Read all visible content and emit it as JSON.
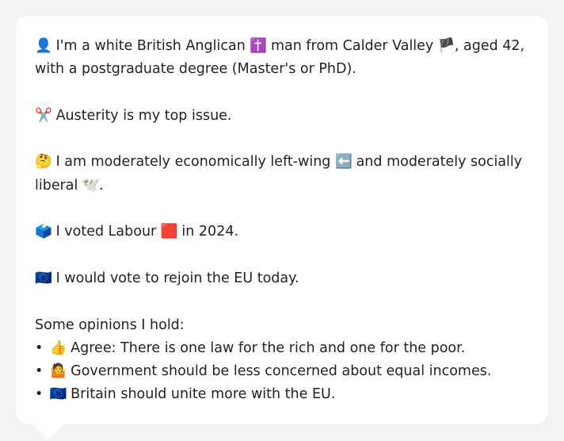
{
  "profile": {
    "identity_icon": "👤",
    "identity_text_1": "I'm a white British Anglican",
    "religion_icon": "✝️",
    "identity_text_2": "man from Calder Valley",
    "flag_icon": "🏴",
    "identity_text_3": ", aged 42, with a postgraduate degree (Master's or PhD)."
  },
  "top_issue": {
    "icon": "✂️",
    "text": "Austerity is my top issue."
  },
  "ideology": {
    "icon": "🤔",
    "text_1": "I am moderately economically left-wing",
    "left_icon": "⬅️",
    "text_2": "and moderately socially liberal",
    "dove_icon": "🕊️",
    "text_3": "."
  },
  "vote": {
    "icon": "🗳️",
    "text_1": "I voted Labour",
    "party_icon": "🟥",
    "text_2": "in 2024."
  },
  "eu": {
    "icon": "🇪🇺",
    "text": "I would vote to rejoin the EU today."
  },
  "opinions": {
    "heading": "Some opinions I hold:",
    "bullet": "•",
    "items": [
      {
        "icon": "👍",
        "text": "Agree: There is one law for the rich and one for the poor."
      },
      {
        "icon": "🤷",
        "text": "Government should be less concerned about equal incomes."
      },
      {
        "icon": "🇪🇺",
        "text": "Britain should unite more with the EU."
      }
    ]
  }
}
